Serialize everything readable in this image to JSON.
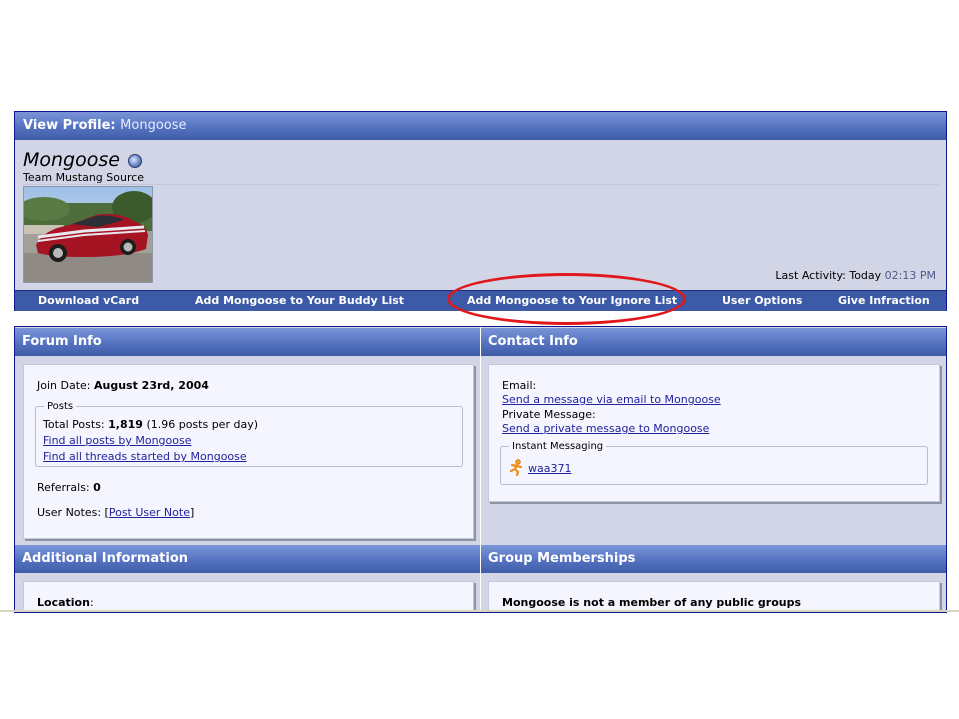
{
  "profile": {
    "header_label": "View Profile",
    "header_sep": ": ",
    "header_user": "Mongoose",
    "username": "Mongoose",
    "user_title": "Team Mustang Source",
    "last_activity_label": "Last Activity: Today",
    "last_activity_time": "02:13 PM",
    "tabs": [
      "Download vCard",
      "Add Mongoose to Your Buddy List",
      "Add Mongoose to Your Ignore List",
      "User Options",
      "Give Infraction"
    ],
    "highlight_color": "#e0181c"
  },
  "forum_info": {
    "title": "Forum Info",
    "join_date_label": "Join Date:",
    "join_date_value": "August 23rd, 2004",
    "posts_legend": "Posts",
    "total_posts_label": "Total Posts:",
    "total_posts_value": "1,819",
    "posts_per_day": "(1.96 posts per day)",
    "find_posts_link": "Find all posts by Mongoose",
    "find_threads_link": "Find all threads started by Mongoose",
    "referrals_label": "Referrals:",
    "referrals_value": "0",
    "user_notes_label": "User Notes: [",
    "user_notes_link": "Post User Note",
    "user_notes_close": "]"
  },
  "contact_info": {
    "title": "Contact Info",
    "email_label": "Email:",
    "email_link": "Send a message via email to Mongoose",
    "pm_label": "Private Message:",
    "pm_link": "Send a private message to Mongoose",
    "im_legend": "Instant Messaging",
    "aim_icon": "aim-running-man-icon",
    "aim_handle": "waa371"
  },
  "additional_info": {
    "title": "Additional Information",
    "location_label": "Location",
    "location_colon": ":"
  },
  "group_memberships": {
    "title": "Group Memberships",
    "message": "Mongoose is not a member of any public groups"
  },
  "colors": {
    "header_gradient_top": "#7a95d6",
    "header_gradient_bottom": "#3f5ca6",
    "panel_bg": "#d1d5e6",
    "link": "#22229c"
  }
}
